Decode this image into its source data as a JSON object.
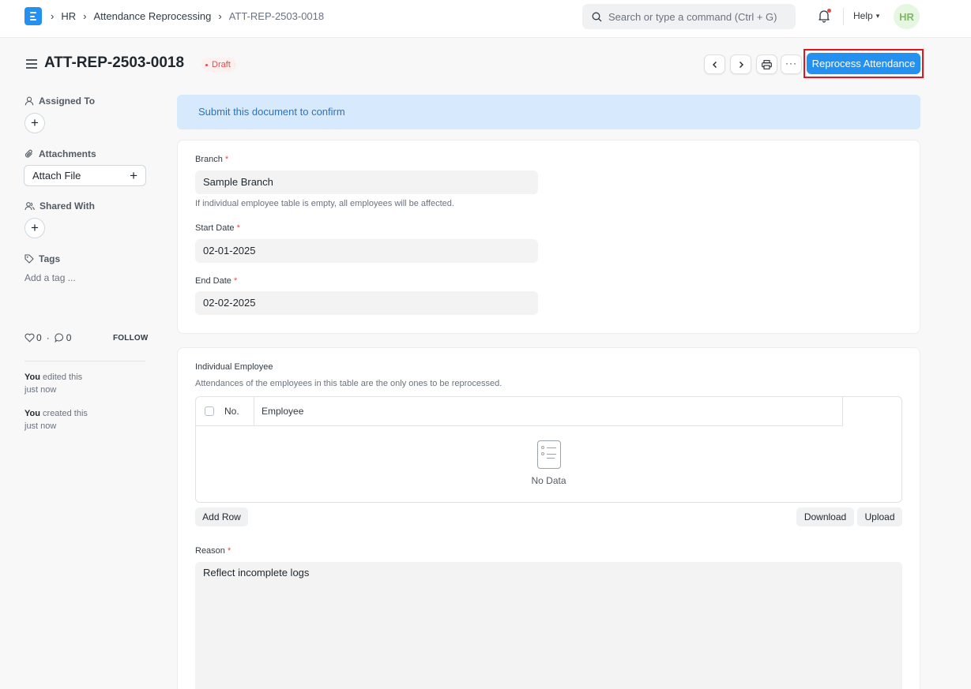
{
  "navbar": {
    "breadcrumbs": [
      "HR",
      "Attendance Reprocessing",
      "ATT-REP-2503-0018"
    ],
    "search_placeholder": "Search or type a command (Ctrl + G)",
    "help_label": "Help",
    "avatar_initials": "HR"
  },
  "header": {
    "title": "ATT-REP-2503-0018",
    "status": "Draft",
    "primary_action": "Reprocess Attendance"
  },
  "sidebar": {
    "assigned_to": "Assigned To",
    "attachments": "Attachments",
    "attach_file": "Attach File",
    "shared_with": "Shared With",
    "tags": "Tags",
    "add_tag": "Add a tag ...",
    "likes": "0",
    "comments": "0",
    "follow": "FOLLOW",
    "activity": [
      {
        "user": "You",
        "action": "edited this",
        "time": "just now"
      },
      {
        "user": "You",
        "action": "created this",
        "time": "just now"
      }
    ]
  },
  "form": {
    "alert": "Submit this document to confirm",
    "branch_label": "Branch",
    "branch_value": "Sample Branch",
    "branch_hint": "If individual employee table is empty, all employees will be affected.",
    "start_date_label": "Start Date",
    "start_date_value": "02-01-2025",
    "end_date_label": "End Date",
    "end_date_value": "02-02-2025",
    "employee_section_label": "Individual Employee",
    "employee_section_hint": "Attendances of the employees in this table are the only ones to be reprocessed.",
    "table_col_no": "No.",
    "table_col_employee": "Employee",
    "no_data": "No Data",
    "add_row": "Add Row",
    "download": "Download",
    "upload": "Upload",
    "reason_label": "Reason",
    "reason_value": "Reflect incomplete logs"
  }
}
